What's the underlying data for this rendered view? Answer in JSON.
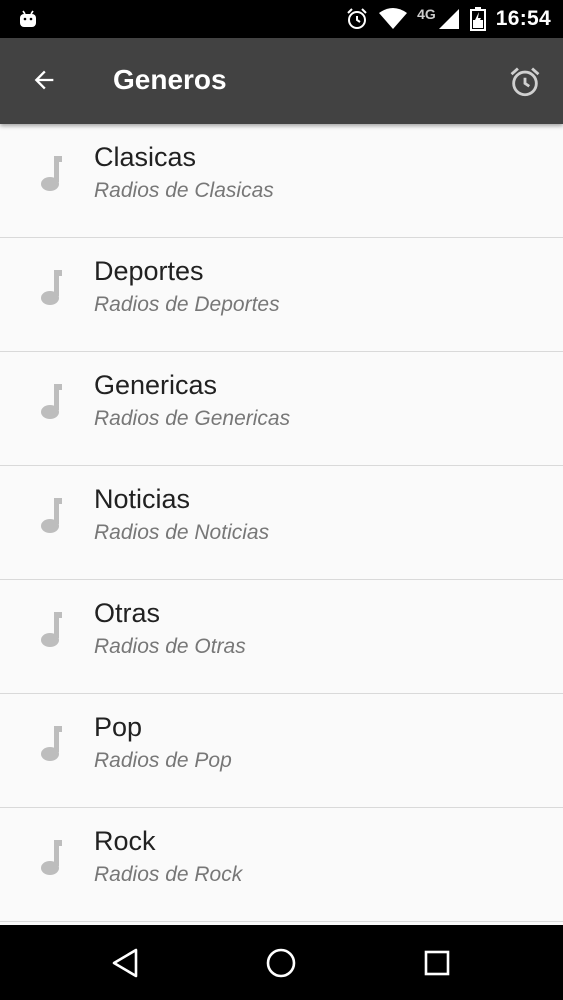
{
  "status_bar": {
    "network": "4G",
    "time": "16:54",
    "icons": [
      "android-icon",
      "alarm-icon",
      "wifi-icon",
      "signal-icon",
      "battery-icon"
    ]
  },
  "app_bar": {
    "title": "Generos",
    "back_icon": "arrow-left-icon",
    "action_icon": "alarm-clock-icon"
  },
  "genres": [
    {
      "name": "Clasicas",
      "subtitle": "Radios de Clasicas"
    },
    {
      "name": "Deportes",
      "subtitle": "Radios de Deportes"
    },
    {
      "name": "Genericas",
      "subtitle": "Radios de Genericas"
    },
    {
      "name": "Noticias",
      "subtitle": "Radios de Noticias"
    },
    {
      "name": "Otras",
      "subtitle": "Radios de Otras"
    },
    {
      "name": "Pop",
      "subtitle": "Radios de Pop"
    },
    {
      "name": "Rock",
      "subtitle": "Radios de Rock"
    }
  ],
  "nav_bar": {
    "icons": [
      "back-triangle-icon",
      "home-circle-icon",
      "recents-square-icon"
    ]
  },
  "colors": {
    "app_bar": "#424242",
    "list_background": "#fafafa",
    "title_text": "#212121",
    "subtitle_text": "#777777",
    "icon_gray": "#bdbdbd"
  }
}
